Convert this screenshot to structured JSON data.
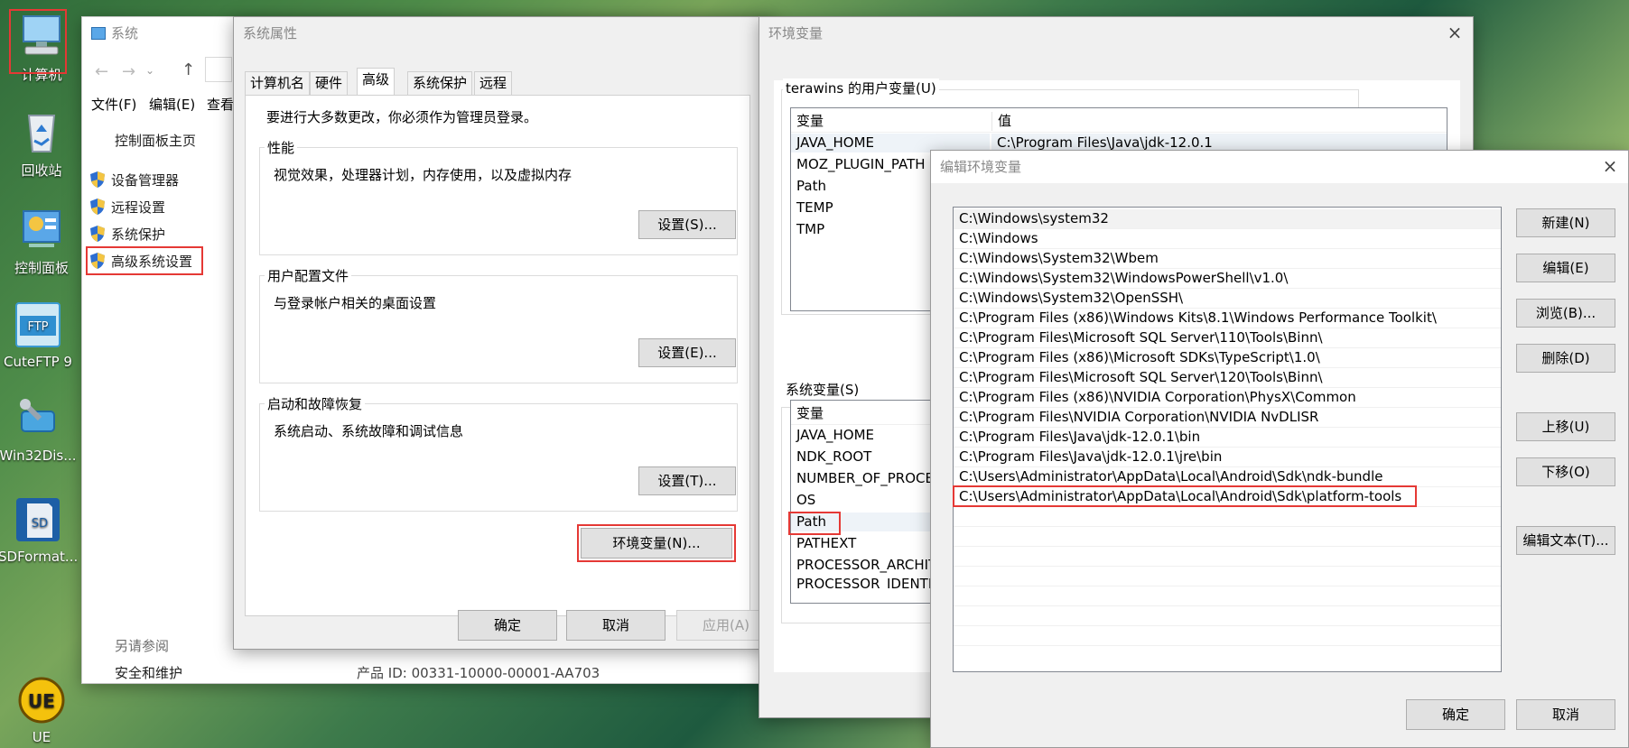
{
  "desktop": {
    "icons": [
      {
        "label": "计算机",
        "icon": "computer-icon"
      },
      {
        "label": "回收站",
        "icon": "recycle-bin-icon"
      },
      {
        "label": "控制面板",
        "icon": "control-panel-icon"
      },
      {
        "label": "CuteFTP 9",
        "icon": "cuteftp-icon"
      },
      {
        "label": "Win32Dis...",
        "icon": "win32diskimager-icon"
      },
      {
        "label": "SDFormat...",
        "icon": "sdformatter-icon"
      },
      {
        "label": "UE",
        "icon": "ultraedit-icon"
      }
    ]
  },
  "system_window": {
    "title": "系统",
    "menu": [
      "文件(F)",
      "编辑(E)",
      "查看"
    ],
    "home_link": "控制面板主页",
    "links": [
      "设备管理器",
      "远程设置",
      "系统保护",
      "高级系统设置"
    ],
    "see_also": "另请参阅",
    "see_also_link": "安全和维护",
    "product_id": "产品 ID: 00331-10000-00001-AA703"
  },
  "sysprops": {
    "title": "系统属性",
    "tabs": [
      "计算机名",
      "硬件",
      "高级",
      "系统保护",
      "远程"
    ],
    "admin_note": "要进行大多数更改，你必须作为管理员登录。",
    "perf": {
      "label": "性能",
      "desc": "视觉效果，处理器计划，内存使用，以及虚拟内存",
      "button": "设置(S)..."
    },
    "profile": {
      "label": "用户配置文件",
      "desc": "与登录帐户相关的桌面设置",
      "button": "设置(E)..."
    },
    "startup": {
      "label": "启动和故障恢复",
      "desc": "系统启动、系统故障和调试信息",
      "button": "设置(T)..."
    },
    "env_button": "环境变量(N)...",
    "ok": "确定",
    "cancel": "取消",
    "apply": "应用(A)"
  },
  "envvars": {
    "title": "环境变量",
    "user_label": "terawins 的用户变量(U)",
    "col_var": "变量",
    "col_val": "值",
    "user_rows": [
      "JAVA_HOME",
      "MOZ_PLUGIN_PATH",
      "Path",
      "TEMP",
      "TMP"
    ],
    "user_java_value": "C:\\Program Files\\Java\\jdk-12.0.1",
    "sys_label": "系统变量(S)",
    "sys_rows": [
      "JAVA_HOME",
      "NDK_ROOT",
      "NUMBER_OF_PROCE",
      "OS",
      "Path",
      "PATHEXT",
      "PROCESSOR_ARCHIT",
      "PROCESSOR_IDENTIF"
    ]
  },
  "editenv": {
    "title": "编辑环境变量",
    "paths": [
      "C:\\Windows\\system32",
      "C:\\Windows",
      "C:\\Windows\\System32\\Wbem",
      "C:\\Windows\\System32\\WindowsPowerShell\\v1.0\\",
      "C:\\Windows\\System32\\OpenSSH\\",
      "C:\\Program Files (x86)\\Windows Kits\\8.1\\Windows Performance Toolkit\\",
      "C:\\Program Files\\Microsoft SQL Server\\110\\Tools\\Binn\\",
      "C:\\Program Files (x86)\\Microsoft SDKs\\TypeScript\\1.0\\",
      "C:\\Program Files\\Microsoft SQL Server\\120\\Tools\\Binn\\",
      "C:\\Program Files (x86)\\NVIDIA Corporation\\PhysX\\Common",
      "C:\\Program Files\\NVIDIA Corporation\\NVIDIA NvDLISR",
      "C:\\Program Files\\Java\\jdk-12.0.1\\bin",
      "C:\\Program Files\\Java\\jdk-12.0.1\\jre\\bin",
      "C:\\Users\\Administrator\\AppData\\Local\\Android\\Sdk\\ndk-bundle",
      "C:\\Users\\Administrator\\AppData\\Local\\Android\\Sdk\\platform-tools"
    ],
    "buttons": {
      "new": "新建(N)",
      "edit": "编辑(E)",
      "browse": "浏览(B)...",
      "delete": "删除(D)",
      "up": "上移(U)",
      "down": "下移(O)",
      "edit_text": "编辑文本(T)..."
    },
    "ok": "确定",
    "cancel": "取消"
  },
  "colors": {
    "highlight": "#e53935",
    "selection": "#cce8ff"
  }
}
